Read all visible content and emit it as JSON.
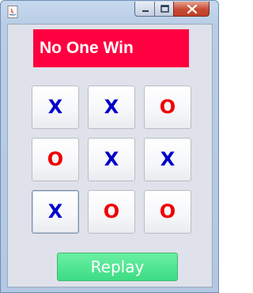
{
  "status": {
    "text": "No One Win",
    "background": "#ff0040"
  },
  "board": [
    [
      "X",
      "X",
      "O"
    ],
    [
      "O",
      "X",
      "X"
    ],
    [
      "X",
      "O",
      "O"
    ]
  ],
  "focused_cell": "row-3-col-1",
  "replay": {
    "label": "Replay",
    "color": "#3ddc84"
  },
  "colors": {
    "x_mark": "#0000cc",
    "o_mark": "#ee0000"
  },
  "window_controls": {
    "minimize_icon": "minimize-icon",
    "maximize_icon": "maximize-icon",
    "close_icon": "close-icon"
  }
}
